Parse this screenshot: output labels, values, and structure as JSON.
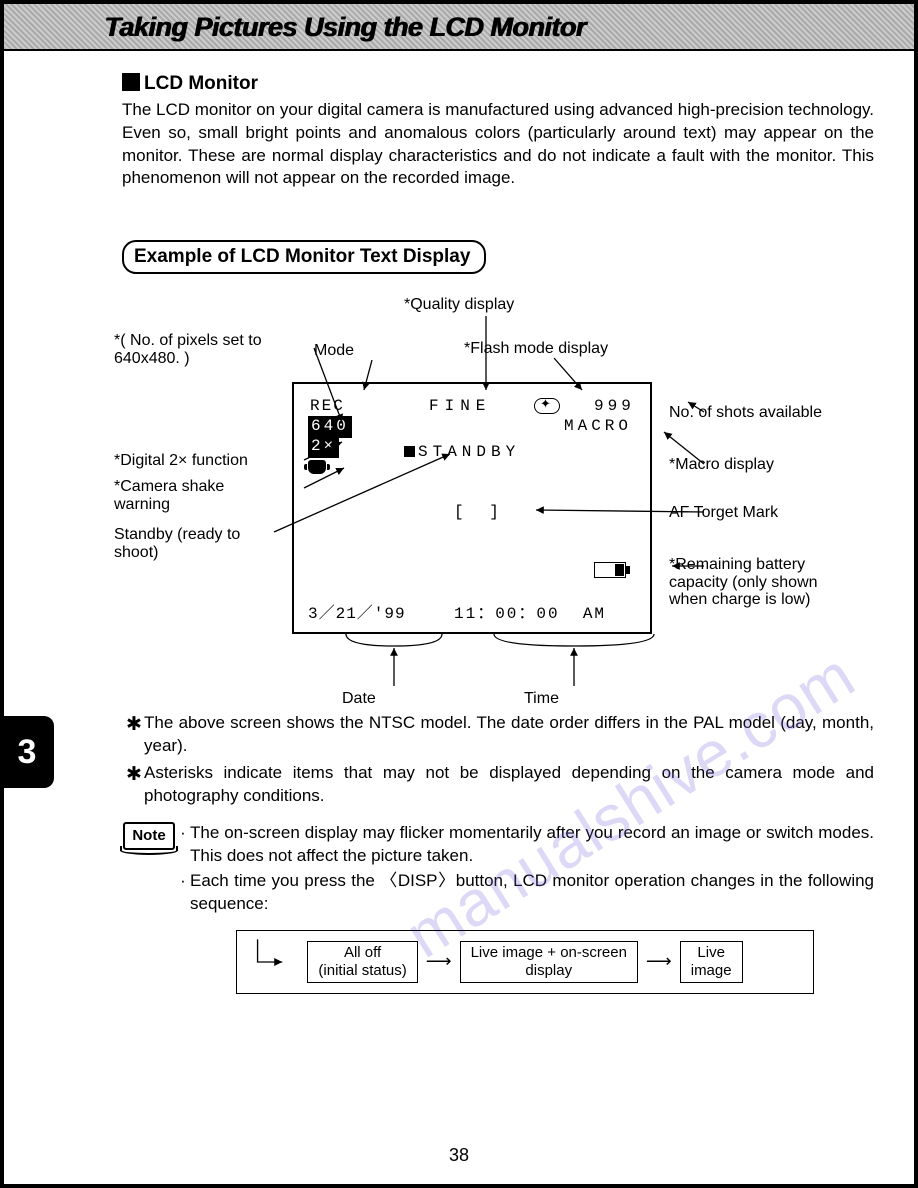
{
  "header": {
    "title": "Taking Pictures Using the LCD Monitor"
  },
  "section": {
    "title": "LCD Monitor",
    "body": "The LCD monitor on your digital camera is manufactured using advanced high-precision technology. Even so, small bright points and anomalous colors (particularly around text) may appear on the monitor. These are normal display characteristics and do not indicate a fault with the monitor. This phenomenon will not appear on the recorded image."
  },
  "example": {
    "title": "Example of LCD Monitor Text Display"
  },
  "lcd": {
    "rec": "REC",
    "res": "640",
    "zoom": "2×",
    "fine": "FINE",
    "shots": "999",
    "macro": "MACRO",
    "standby": "STANDBY",
    "brackets": "[   ]",
    "date": "3／21／'99",
    "time": "11：00：00",
    "ampm": "AM"
  },
  "callouts": {
    "pixels": "No. of pixels set to 640x480.",
    "mode": "Mode",
    "quality": "Quality display",
    "flash": "Flash mode display",
    "shots": "No. of shots available",
    "digital2x": "Digital 2× function",
    "shake": "Camera shake warning",
    "standby": "Standby (ready to shoot)",
    "macro": "Macro display",
    "aftarget": "AF Torget Mark",
    "battery": "Remaining battery capacity (only shown when charge is low)",
    "date": "Date",
    "time": "Time"
  },
  "footnotes": {
    "a": "The above screen shows the NTSC model. The date order differs in the PAL model (day, month, year).",
    "b": "Asterisks indicate items that may not be displayed depending on the camera mode and photography conditions."
  },
  "note": {
    "label": "Note",
    "a": "The on-screen display may flicker momentarily after you record an image or switch modes. This does not affect the picture taken.",
    "b": "Each time you press the 〈DISP〉button, LCD monitor operation changes in the following sequence:"
  },
  "flow": {
    "b1a": "All off",
    "b1b": "(initial status)",
    "b2a": "Live image + on-screen",
    "b2b": "display",
    "b3a": "Live",
    "b3b": "image"
  },
  "chapter": "3",
  "pagenum": "38",
  "watermark": "manualshive.com"
}
